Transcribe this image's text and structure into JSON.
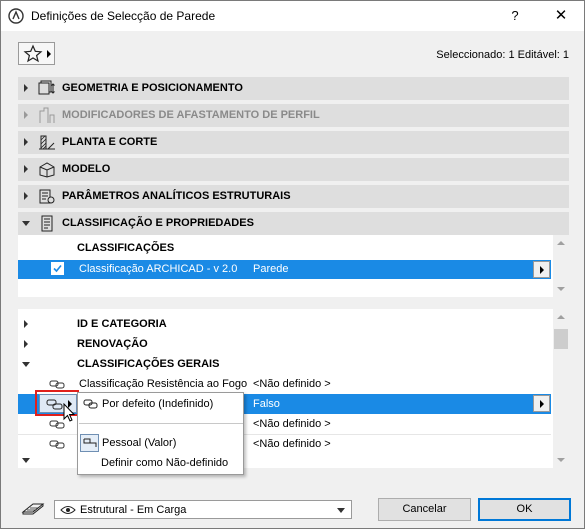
{
  "window": {
    "title": "Definições de Selecção de Parede",
    "help_label": "?",
    "close_label": "✕"
  },
  "selection_info": "Seleccionado: 1 Editável: 1",
  "panels": [
    {
      "label": "GEOMETRIA E POSICIONAMENTO",
      "icon": "geometry-icon",
      "enabled": true,
      "open": false
    },
    {
      "label": "MODIFICADORES DE AFASTAMENTO DE PERFIL",
      "icon": "profile-offset-icon",
      "enabled": false,
      "open": false
    },
    {
      "label": "PLANTA E CORTE",
      "icon": "floor-plan-icon",
      "enabled": true,
      "open": false
    },
    {
      "label": "MODELO",
      "icon": "model-icon",
      "enabled": true,
      "open": false
    },
    {
      "label": "PARÂMETROS ANALÍTICOS ESTRUTURAIS",
      "icon": "structural-icon",
      "enabled": true,
      "open": false
    },
    {
      "label": "CLASSIFICAÇÃO E PROPRIEDADES",
      "icon": "classification-icon",
      "enabled": true,
      "open": true
    }
  ],
  "classifications": {
    "heading": "CLASSIFICAÇÕES",
    "rows": [
      {
        "name": "Classificação ARCHICAD - v 2.0",
        "value": "Parede",
        "checked": true
      }
    ]
  },
  "properties": {
    "groups": [
      {
        "label": "ID E CATEGORIA"
      },
      {
        "label": "RENOVAÇÃO"
      },
      {
        "label": "CLASSIFICAÇÕES GERAIS"
      }
    ],
    "rows": [
      {
        "name": "Classificação Resistência ao Fogo",
        "value": "<Não definido >"
      },
      {
        "name": "",
        "value": "Falso"
      },
      {
        "name": "",
        "value": "<Não definido >"
      },
      {
        "name": "",
        "value": "<Não definido >"
      }
    ]
  },
  "popup_menu": {
    "items": [
      {
        "label": "Por defeito (Indefinido)",
        "icon": "default-link-icon"
      },
      {
        "label": "Pessoal (Valor)",
        "icon": "custom-link-icon"
      },
      {
        "label": "Definir como Não-definido",
        "icon": ""
      }
    ]
  },
  "footer": {
    "structural_function": "Estrutural - Em Carga",
    "cancel_label": "Cancelar",
    "ok_label": "OK"
  },
  "colors": {
    "selection": "#1a8ae5",
    "highlight_border": "#e0201c",
    "panel_bg": "#dedede"
  }
}
